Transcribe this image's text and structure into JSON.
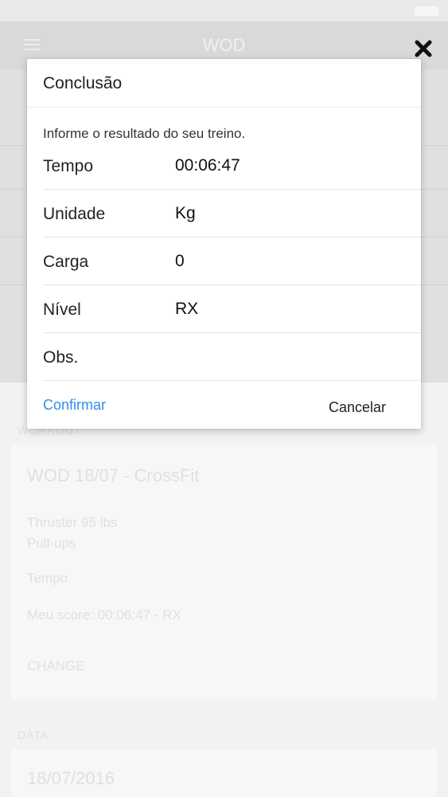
{
  "status_bar": {
    "carrier": "",
    "time": ""
  },
  "nav": {
    "title": "WOD"
  },
  "background": {
    "section_workout_label": "WORKOUT",
    "wod_title": "WOD 18/07 - CrossFit",
    "exercises": [
      "Thruster 95 lbs",
      "Pull-ups"
    ],
    "workout_type": "Tempo",
    "score_line": "Meu score: 00:06:47 - RX",
    "change_button": "CHANGE",
    "section_date_label": "DATA",
    "date_value": "18/07/2016"
  },
  "dialog": {
    "title": "Conclusão",
    "message": "Informe o resultado do seu treino.",
    "fields": [
      {
        "label": "Tempo",
        "value": "00:06:47"
      },
      {
        "label": "Unidade",
        "value": "Kg"
      },
      {
        "label": "Carga",
        "value": "0"
      },
      {
        "label": "Nível",
        "value": "RX"
      },
      {
        "label": "Obs.",
        "value": ""
      }
    ],
    "confirm_label": "Confirmar",
    "cancel_label": "Cancelar"
  },
  "icons": {
    "close": "close-icon",
    "menu": "menu-icon"
  },
  "colors": {
    "accent": "#2f8ee8",
    "dialog_bg": "#ffffff",
    "overlay_upper": "#e0e0e0",
    "overlay_lower": "#f2f2f2"
  }
}
